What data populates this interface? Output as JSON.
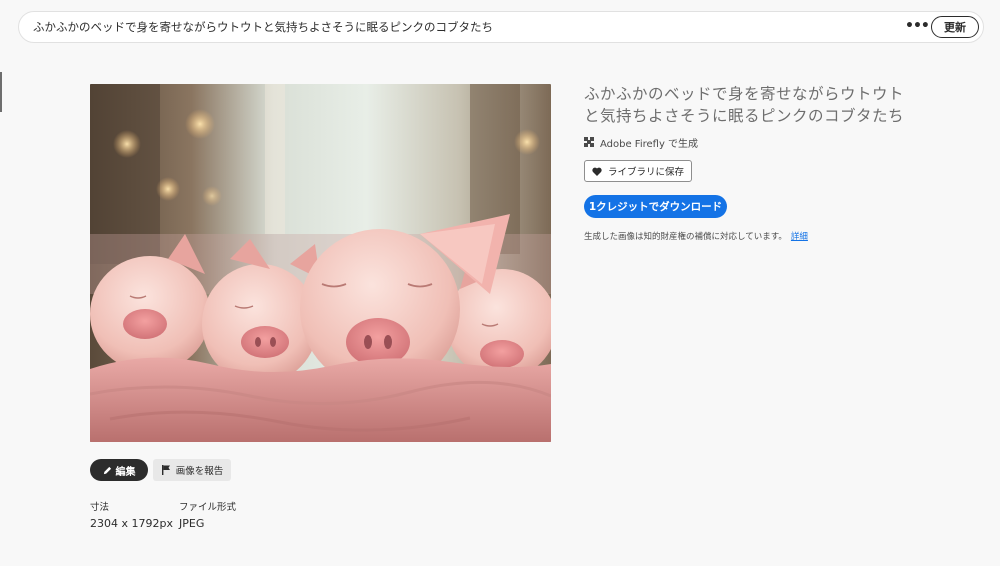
{
  "prompt": {
    "text": "ふかふかのベッドで身を寄せながらウトウトと気持ちよさそうに眠るピンクのコブタたち",
    "more_label": "•••",
    "refresh_label": "更新"
  },
  "image": {
    "alt": "ふかふかのベッドで身を寄せながらウトウトと気持ちよさそうに眠るピンクのコブタたち"
  },
  "details": {
    "title": "ふかふかのベッドで身を寄せながらウトウトと気持ちよさそうに眠るピンクのコブタたち",
    "generator_label": "Adobe Firefly で生成",
    "save_label": "ライブラリに保存",
    "download_label": "1クレジットでダウンロード",
    "ip_note": "生成した画像は知的財産権の補償に対応しています。",
    "ip_link": "詳細"
  },
  "actions": {
    "edit_label": "編集",
    "report_label": "画像を報告"
  },
  "meta": {
    "size_label": "寸法",
    "size_value": "2304 x 1792px",
    "format_label": "ファイル形式",
    "format_value": "JPEG"
  },
  "colors": {
    "accent": "#1473e6",
    "dark": "#2c2c2c",
    "background": "#f8f8f8"
  },
  "icons": {
    "generator": "firefly-icon",
    "save": "heart-icon",
    "edit": "pencil-icon",
    "report": "flag-icon"
  }
}
